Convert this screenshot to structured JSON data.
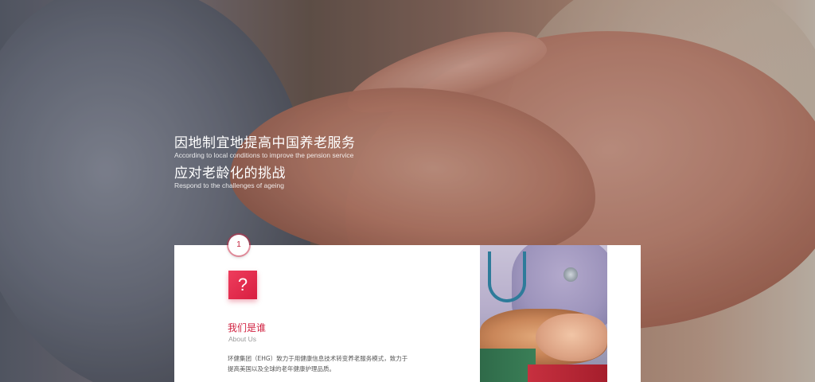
{
  "hero": {
    "line1_zh": "因地制宜地提高中国养老服务",
    "line1_en": "According to local conditions to improve the pension service",
    "line2_zh": "应对老龄化的挑战",
    "line2_en": "Respond to the challenges of ageing"
  },
  "about": {
    "step_number": "1",
    "icon_glyph": "?",
    "icon_name": "question-icon",
    "title": "我们是谁",
    "subtitle": "About Us",
    "body": "环健集团（EHG）致力于用健康信息技术转变养老服务模式，致力于提高美国以及全球的老年健康护理品质。"
  },
  "colors": {
    "accent": "#d81e40",
    "card_bg": "#ffffff"
  },
  "photo": {
    "icon_name": "caregiver-hands-photo"
  }
}
